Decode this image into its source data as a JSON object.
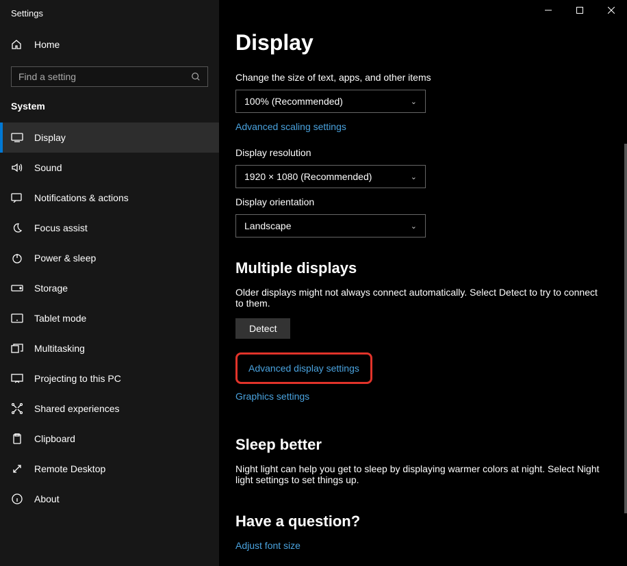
{
  "app_title": "Settings",
  "home_label": "Home",
  "search_placeholder": "Find a setting",
  "category_label": "System",
  "nav": [
    {
      "label": "Display",
      "selected": true
    },
    {
      "label": "Sound",
      "selected": false
    },
    {
      "label": "Notifications & actions",
      "selected": false
    },
    {
      "label": "Focus assist",
      "selected": false
    },
    {
      "label": "Power & sleep",
      "selected": false
    },
    {
      "label": "Storage",
      "selected": false
    },
    {
      "label": "Tablet mode",
      "selected": false
    },
    {
      "label": "Multitasking",
      "selected": false
    },
    {
      "label": "Projecting to this PC",
      "selected": false
    },
    {
      "label": "Shared experiences",
      "selected": false
    },
    {
      "label": "Clipboard",
      "selected": false
    },
    {
      "label": "Remote Desktop",
      "selected": false
    },
    {
      "label": "About",
      "selected": false
    }
  ],
  "page": {
    "title": "Display",
    "scale_label": "Change the size of text, apps, and other items",
    "scale_value": "100% (Recommended)",
    "adv_scaling_link": "Advanced scaling settings",
    "resolution_label": "Display resolution",
    "resolution_value": "1920 × 1080 (Recommended)",
    "orientation_label": "Display orientation",
    "orientation_value": "Landscape",
    "multi_title": "Multiple displays",
    "multi_body": "Older displays might not always connect automatically. Select Detect to try to connect to them.",
    "detect_label": "Detect",
    "adv_display_link": "Advanced display settings",
    "graphics_link": "Graphics settings",
    "sleep_title": "Sleep better",
    "sleep_body": "Night light can help you get to sleep by displaying warmer colors at night. Select Night light settings to set things up.",
    "question_title": "Have a question?",
    "adjust_font_link": "Adjust font size"
  }
}
